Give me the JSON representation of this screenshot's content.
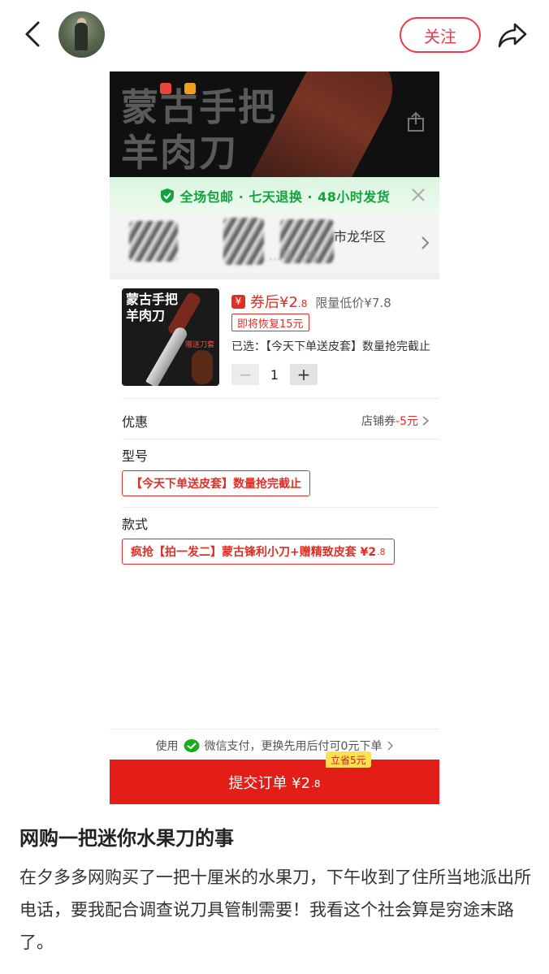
{
  "nav": {
    "follow_label": "关注"
  },
  "screenshot": {
    "banner_title_line1": "蒙古手把",
    "banner_title_line2": "羊肉刀",
    "guarantee_text": "全场包邮 · 七天退换 · 48小时发货",
    "address_line1": "市龙华区",
    "address_line2": "…号…站",
    "product_image_title_line1": "蒙古手把",
    "product_image_title_line2": "羊肉刀",
    "product_image_gift": "赠送刀套",
    "coupon_icon": "¥",
    "price_label": "券后¥2",
    "price_decimal": ".8",
    "low_price": "限量低价¥7.8",
    "restore_tag": "即将恢复15元",
    "selected_text": "已选：【今天下单送皮套】数量抢完截止",
    "qty_minus": "−",
    "qty_value": "1",
    "qty_plus": "+",
    "discount_label": "优惠",
    "discount_store": "店铺券",
    "discount_value": "-5元",
    "model_label": "型号",
    "model_option": "【今天下单送皮套】数量抢完截止",
    "style_label": "款式",
    "style_option": "疯抢【拍一发二】蒙古锋利小刀+赠精致皮套 ¥2",
    "style_option_decimal": ".8",
    "pay_note_prefix": "使用",
    "pay_note_suffix": "微信支付，更换先用后付可0元下单",
    "save_tag": "立省5元",
    "submit_label": "提交订单 ¥2",
    "submit_decimal": ".8"
  },
  "post": {
    "title": "网购一把迷你水果刀的事",
    "body": "在夕多多网购买了一把十厘米的水果刀，下午收到了住所当地派出所电话，要我配合调查说刀具管制需要！我看这个社会算是穷途末路了。"
  },
  "colors": {
    "accent_red": "#e02e24",
    "follow_red": "#f0394d",
    "guarantee_green": "#14a23d",
    "wechat_green": "#1aad19",
    "save_yellow": "#ffe14d"
  },
  "icons": [
    "back-arrow-icon",
    "avatar",
    "share-icon",
    "upload-icon",
    "shield-check-icon",
    "close-icon",
    "chevron-right-icon",
    "wechat-pay-icon"
  ]
}
